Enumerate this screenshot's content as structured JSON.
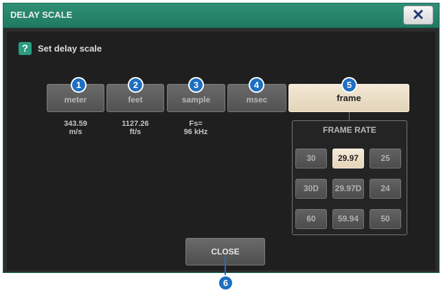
{
  "dialog": {
    "title": "DELAY SCALE",
    "close_icon_glyph": "✕",
    "help_glyph": "?",
    "subtitle": "Set delay scale"
  },
  "scale_buttons": [
    {
      "label": "meter",
      "callout": "1",
      "info_line1": "343.59",
      "info_line2": "m/s"
    },
    {
      "label": "feet",
      "callout": "2",
      "info_line1": "1127.26",
      "info_line2": "ft/s"
    },
    {
      "label": "sample",
      "callout": "3",
      "info_line1": "Fs=",
      "info_line2": "96 kHz"
    },
    {
      "label": "msec",
      "callout": "4"
    },
    {
      "label": "frame",
      "callout": "5",
      "selected": true
    }
  ],
  "frame_rate": {
    "title": "FRAME RATE",
    "options": [
      "30",
      "29.97",
      "25",
      "30D",
      "29.97D",
      "24",
      "60",
      "59.94",
      "50"
    ],
    "selected": "29.97"
  },
  "close_button": {
    "label": "CLOSE",
    "callout": "6"
  },
  "colors": {
    "title_bar": "#1f7a61",
    "selected": "#ecdfc8",
    "callout": "#1e6fc1"
  }
}
